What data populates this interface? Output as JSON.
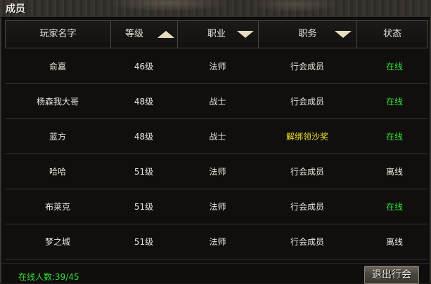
{
  "window": {
    "title": "成员"
  },
  "table": {
    "headers": [
      {
        "label": "玩家名字"
      },
      {
        "label": "等级",
        "sort": "ascending"
      },
      {
        "label": "职业",
        "sort": "descending"
      },
      {
        "label": "职务",
        "sort": "descending"
      },
      {
        "label": "状态"
      }
    ],
    "rows": [
      {
        "name": "俞嘉",
        "level": "46级",
        "class": "法师",
        "role": "行会成员",
        "status": "在线",
        "online": true,
        "role_highlight": false
      },
      {
        "name": "杨森我大哥",
        "level": "48级",
        "class": "战士",
        "role": "行会成员",
        "status": "在线",
        "online": true,
        "role_highlight": false
      },
      {
        "name": "蓝方",
        "level": "48级",
        "class": "战士",
        "role": "解绑领沙奖",
        "status": "在线",
        "online": true,
        "role_highlight": true
      },
      {
        "name": "哈哈",
        "level": "51级",
        "class": "法师",
        "role": "行会成员",
        "status": "离线",
        "online": false,
        "role_highlight": false
      },
      {
        "name": "布莱克",
        "level": "51级",
        "class": "法师",
        "role": "行会成员",
        "status": "在线",
        "online": true,
        "role_highlight": false
      },
      {
        "name": "梦之城",
        "level": "51级",
        "class": "法师",
        "role": "行会成员",
        "status": "离线",
        "online": false,
        "role_highlight": false
      }
    ]
  },
  "footer": {
    "online_count": "在线人数:39/45",
    "quit_button": "退出行会"
  },
  "colors": {
    "online": "#33dd33",
    "highlight_role": "#f2e22a",
    "text": "#ece8de"
  },
  "icons": [
    "sort-ascending-icon",
    "sort-descending-icon"
  ]
}
